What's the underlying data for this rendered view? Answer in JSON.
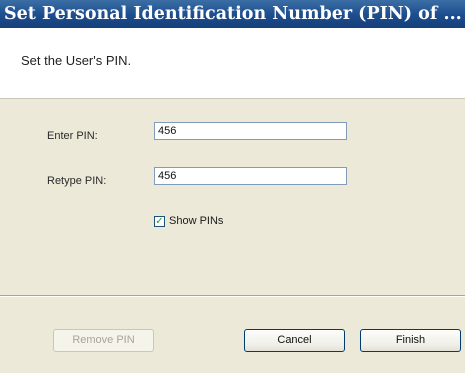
{
  "window": {
    "title": "Set Personal Identification Number (PIN) of ..."
  },
  "header": {
    "text": "Set the User's PIN."
  },
  "form": {
    "enter_pin_label": "Enter PIN:",
    "enter_pin_value": "456",
    "retype_pin_label": "Retype PIN:",
    "retype_pin_value": "456",
    "show_pins_label": "Show PINs",
    "show_pins_checked": true
  },
  "buttons": {
    "remove_pin": "Remove PIN",
    "cancel": "Cancel",
    "finish": "Finish"
  }
}
